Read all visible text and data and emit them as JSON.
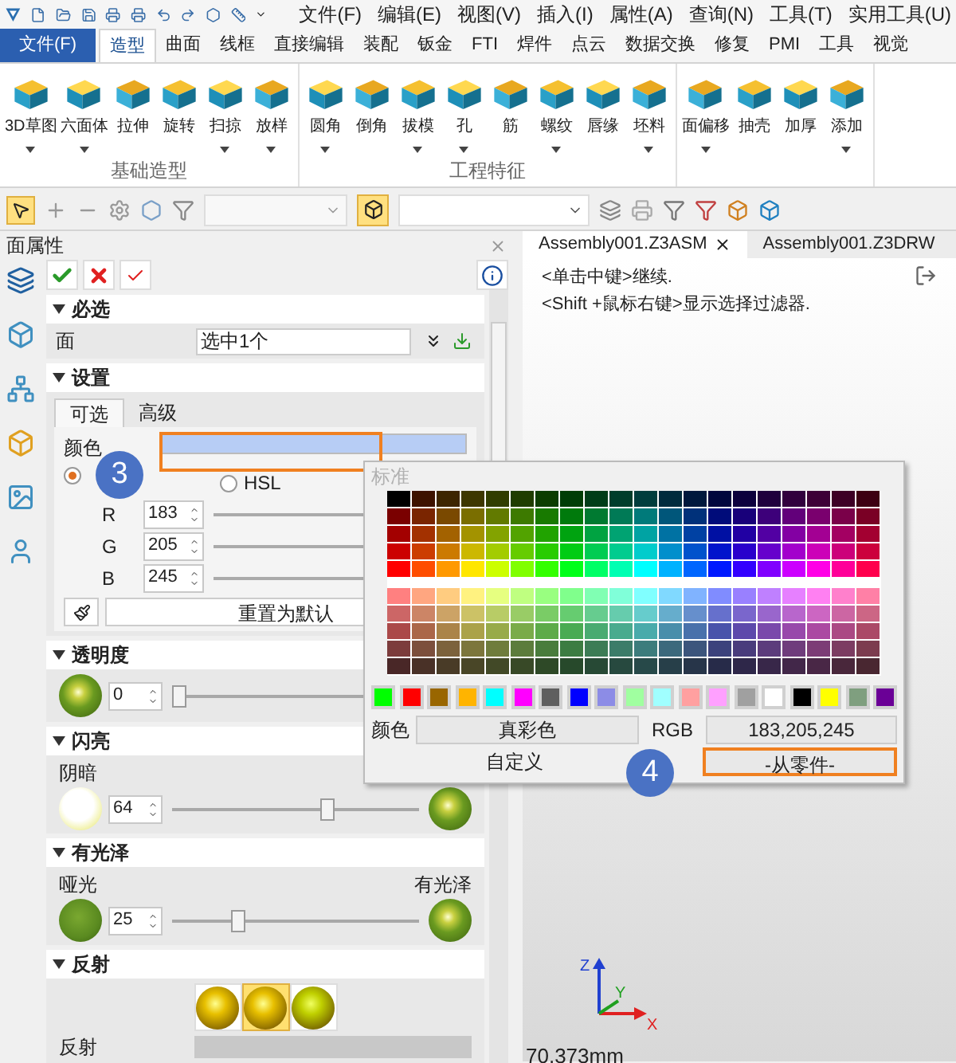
{
  "quick_toolbar": {
    "menus": [
      "文件(F)",
      "编辑(E)",
      "视图(V)",
      "插入(I)",
      "属性(A)",
      "查询(N)",
      "工具(T)",
      "实用工具(U)"
    ]
  },
  "ribbon_tabs": [
    {
      "label": "文件(F)",
      "kind": "file",
      "selected": false
    },
    {
      "label": "造型",
      "kind": "tab",
      "selected": true
    },
    {
      "label": "曲面",
      "kind": "tab",
      "selected": false
    },
    {
      "label": "线框",
      "kind": "tab",
      "selected": false
    },
    {
      "label": "直接编辑",
      "kind": "tab",
      "selected": false
    },
    {
      "label": "装配",
      "kind": "tab",
      "selected": false
    },
    {
      "label": "钣金",
      "kind": "tab",
      "selected": false
    },
    {
      "label": "FTI",
      "kind": "tab",
      "selected": false
    },
    {
      "label": "焊件",
      "kind": "tab",
      "selected": false
    },
    {
      "label": "点云",
      "kind": "tab",
      "selected": false
    },
    {
      "label": "数据交换",
      "kind": "tab",
      "selected": false
    },
    {
      "label": "修复",
      "kind": "tab",
      "selected": false
    },
    {
      "label": "PMI",
      "kind": "tab",
      "selected": false
    },
    {
      "label": "工具",
      "kind": "tab",
      "selected": false
    },
    {
      "label": "视觉",
      "kind": "tab",
      "selected": false
    }
  ],
  "ribbon_groups": [
    {
      "title": "基础造型",
      "tools": [
        {
          "label": "3D草图",
          "dropdown": true
        },
        {
          "label": "六面体",
          "dropdown": true
        },
        {
          "label": "拉伸",
          "dropdown": false
        },
        {
          "label": "旋转",
          "dropdown": false
        },
        {
          "label": "扫掠",
          "dropdown": true
        },
        {
          "label": "放样",
          "dropdown": true
        }
      ]
    },
    {
      "title": "工程特征",
      "tools": [
        {
          "label": "圆角",
          "dropdown": true
        },
        {
          "label": "倒角",
          "dropdown": false
        },
        {
          "label": "拔模",
          "dropdown": true
        },
        {
          "label": "孔",
          "dropdown": true
        },
        {
          "label": "筋",
          "dropdown": false
        },
        {
          "label": "螺纹",
          "dropdown": true
        },
        {
          "label": "唇缘",
          "dropdown": false
        },
        {
          "label": "坯料",
          "dropdown": true
        }
      ]
    },
    {
      "tools": [
        {
          "label": "面偏移",
          "dropdown": true
        },
        {
          "label": "抽壳",
          "dropdown": false
        },
        {
          "label": "加厚",
          "dropdown": false
        },
        {
          "label": "添加",
          "dropdown": true
        }
      ]
    }
  ],
  "panel": {
    "title": "面属性",
    "required": {
      "title": "必选",
      "field_label": "面",
      "value": "选中1个"
    },
    "settings": {
      "title": "设置",
      "tabs": [
        {
          "label": "可选",
          "selected": true
        },
        {
          "label": "高级",
          "selected": false
        }
      ],
      "color_label": "颜色",
      "color": "#b7cdf5",
      "radios": [
        {
          "selected": true
        },
        {
          "label": "HSL",
          "selected": false
        }
      ],
      "channels": [
        {
          "label": "R",
          "value": "183"
        },
        {
          "label": "G",
          "value": "205"
        },
        {
          "label": "B",
          "value": "245"
        }
      ],
      "reset": "重置为默认"
    },
    "transparency": {
      "title": "透明度",
      "value": "0",
      "level": 0
    },
    "shininess": {
      "title": "闪亮",
      "left_label": "阴暗",
      "value": "64",
      "level": 0.64
    },
    "gloss": {
      "title": "有光泽",
      "left_label": "哑光",
      "right_label": "有光泽",
      "value": "25",
      "level": 0.25
    },
    "reflection": {
      "title": "反射",
      "options": [
        {
          "selected": false
        },
        {
          "selected": true
        },
        {
          "selected": false
        }
      ],
      "label": "反射"
    }
  },
  "color_popup": {
    "header": "标准",
    "swatches": [
      {
        "color": "#00ff00"
      },
      {
        "color": "#ff0000"
      },
      {
        "color": "#996600"
      },
      {
        "color": "#ffb400"
      },
      {
        "color": "#00ffff"
      },
      {
        "color": "#ff00ff"
      },
      {
        "color": "#5f5f5f"
      },
      {
        "color": "#0000ff"
      },
      {
        "color": "#8c8ce6"
      },
      {
        "color": "#a0ffa0"
      },
      {
        "color": "#a0ffff"
      },
      {
        "color": "#ffa0a0"
      },
      {
        "color": "#ffa0ff"
      },
      {
        "color": "#a0a0a0"
      },
      {
        "color": "#ffffff"
      },
      {
        "color": "#000000"
      },
      {
        "color": "#ffff00"
      },
      {
        "color": "#7f9f7f"
      },
      {
        "color": "#6a0096"
      }
    ],
    "color_label": "颜色",
    "color_mode": "真彩色",
    "rgb_label": "RGB",
    "rgb_value": "183,205,245",
    "custom": "自定义",
    "from_part": "-从零件-"
  },
  "viewport": {
    "tabs": [
      {
        "label": "Assembly001.Z3ASM",
        "selected": true,
        "closable": true
      },
      {
        "label": "Assembly001.Z3DRW",
        "selected": false,
        "closable": false
      }
    ],
    "messages": [
      "<单击中键>继续.",
      "<Shift +鼠标右键>显示选择过滤器."
    ],
    "axes": [
      "X",
      "Y",
      "Z"
    ],
    "measurement": "70.373mm"
  },
  "annotations": [
    {
      "label": "3"
    },
    {
      "label": "4"
    }
  ]
}
